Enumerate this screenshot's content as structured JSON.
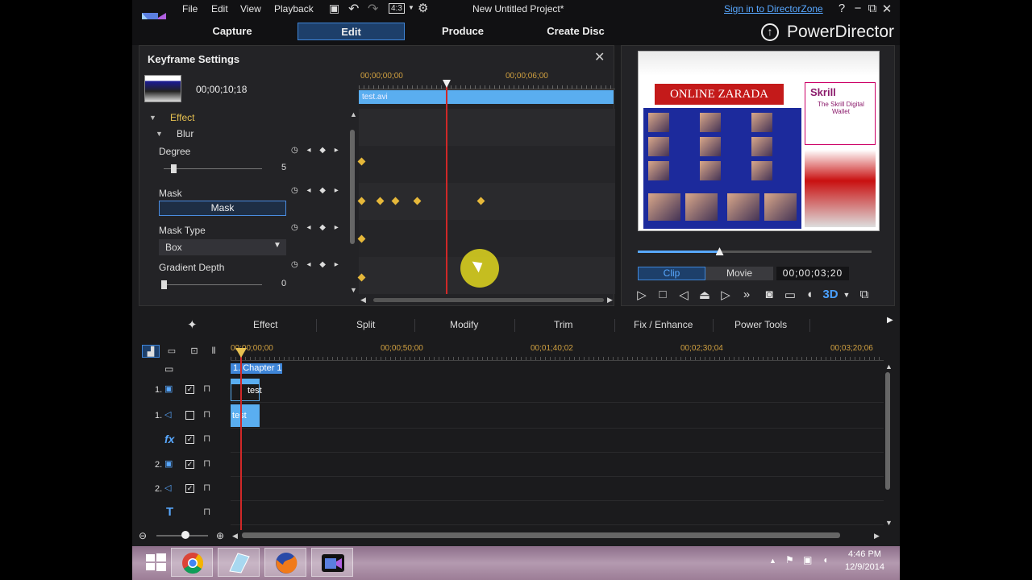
{
  "window": {
    "menu": [
      "File",
      "Edit",
      "View",
      "Playback"
    ],
    "project_title": "New Untitled Project*",
    "signin_link": "Sign in to DirectorZone",
    "controls": {
      "help": "?",
      "minimize": "−",
      "maximize": "⧉",
      "close": "✕"
    }
  },
  "modes": {
    "capture": "Capture",
    "edit": "Edit",
    "produce": "Produce",
    "create_disc": "Create Disc",
    "brand": "PowerDirector"
  },
  "keyframe": {
    "title": "Keyframe Settings",
    "close": "✕",
    "timecode": "00;00;10;18",
    "ruler_labels": [
      "00;00;00;00",
      "00;00;06;00"
    ],
    "clip_name": "test.avi",
    "effect_label": "Effect",
    "blur_label": "Blur",
    "params": {
      "degree": {
        "label": "Degree",
        "value": "5",
        "level": 0.1
      },
      "mask": {
        "label": "Mask",
        "button": "Mask"
      },
      "mask_type": {
        "label": "Mask Type",
        "value": "Box"
      },
      "gradient_depth": {
        "label": "Gradient Depth",
        "value": "0",
        "level": 0.0
      }
    },
    "keyframe_controls": "◷ ◂ ◆ ▸"
  },
  "preview": {
    "banner_text": "ONLINE ZARADA",
    "skrill_title": "Skrill",
    "skrill_sub": "The Skrill Digital Wallet",
    "seek_level": 0.35,
    "clip_tab": "Clip",
    "movie_tab": "Movie",
    "timecode": "00;00;03;20"
  },
  "toolbar": {
    "items": [
      "Effect",
      "Split",
      "Modify",
      "Trim",
      "Fix / Enhance",
      "Power Tools"
    ]
  },
  "timeline": {
    "ruler_labels": [
      "00;00;00;00",
      "00;00;50;00",
      "00;01;40;02",
      "00;02;30;04",
      "00;03;20;06"
    ],
    "chapter": "1. Chapter 1",
    "tracks": [
      {
        "num": "1.",
        "type": "video",
        "checked": true
      },
      {
        "num": "1.",
        "type": "audio",
        "checked": false
      },
      {
        "num": "",
        "type": "fx",
        "checked": true
      },
      {
        "num": "2.",
        "type": "video",
        "checked": true
      },
      {
        "num": "2.",
        "type": "audio",
        "checked": true
      },
      {
        "num": "",
        "type": "title",
        "checked": false
      }
    ],
    "clip_video_label": "test",
    "clip_audio_label": "test",
    "fx_icon": "fx",
    "title_icon": "T"
  },
  "taskbar": {
    "time": "4:46 PM",
    "date": "12/9/2014"
  },
  "colors": {
    "accent": "#3f86d8",
    "clip": "#5aaef0",
    "playhead": "#d02828",
    "keyframe": "#e6b83a"
  }
}
